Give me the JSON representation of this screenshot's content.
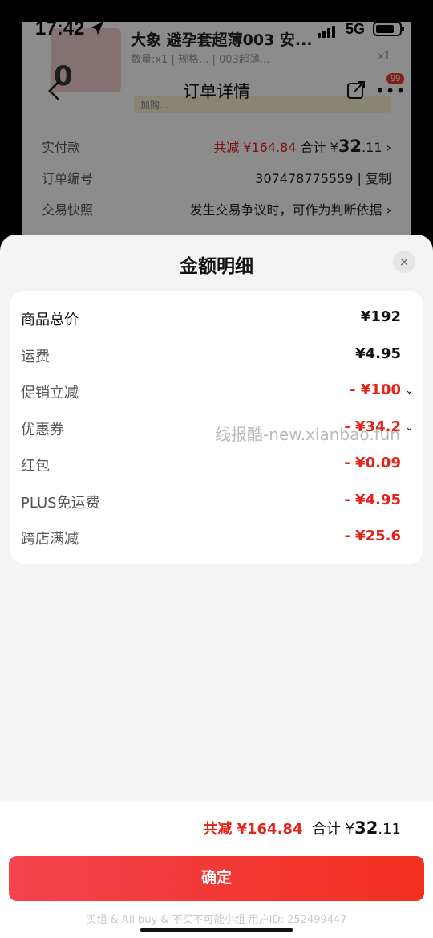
{
  "status_bar": {
    "time": "17:42",
    "network": "5G"
  },
  "background": {
    "product_thumb_text": "0",
    "product_title": "大象 避孕套超薄003 安...",
    "product_subtitle": "数量:x1 | 规格... | 003超薄...",
    "product_qty": "x1",
    "product_chip": "加购...",
    "nav_title": "订单详情",
    "badge_count": "99",
    "info_rows": [
      {
        "label": "实付款",
        "value_red": "共减 ¥164.84",
        "value_prefix": " 合计 ¥",
        "value_main": "32",
        "value_decimal": ".11",
        "arrow": "›"
      },
      {
        "label": "订单编号",
        "value": "307478775559 | 复制"
      },
      {
        "label": "交易快照",
        "value": "发生交易争议时，可作为判断依据 ›"
      }
    ]
  },
  "sheet": {
    "title": "金额明细",
    "close_label": "×",
    "rows": [
      {
        "label": "商品总价",
        "amount": "¥192",
        "red": false,
        "chevron": ""
      },
      {
        "label": "运费",
        "amount": "¥4.95",
        "red": false,
        "chevron": ""
      },
      {
        "label": "促销立减",
        "amount": "- ¥100",
        "red": true,
        "chevron": "⌄"
      },
      {
        "label": "优惠券",
        "amount": "- ¥34.2",
        "red": true,
        "chevron": "⌄"
      },
      {
        "label": "红包",
        "amount": "- ¥0.09",
        "red": true,
        "chevron": ""
      },
      {
        "label": "PLUS免运费",
        "amount": "- ¥4.95",
        "red": true,
        "chevron": ""
      },
      {
        "label": "跨店满减",
        "amount": "- ¥25.6",
        "red": true,
        "chevron": ""
      }
    ],
    "watermark": "线报酷-new.xianbao.fun",
    "footer": {
      "discount": "共减 ¥164.84",
      "total_prefix": "合计 ¥",
      "total_main": "32",
      "total_decimal": ".11",
      "confirm_label": "确定",
      "note": "买组 & All buy & 不买不可能小组 用户ID: 252499447"
    }
  },
  "colors": {
    "accent_red": "#e1251b",
    "button_start": "#f4434f",
    "button_end": "#f1301e",
    "badge": "#e53935"
  }
}
